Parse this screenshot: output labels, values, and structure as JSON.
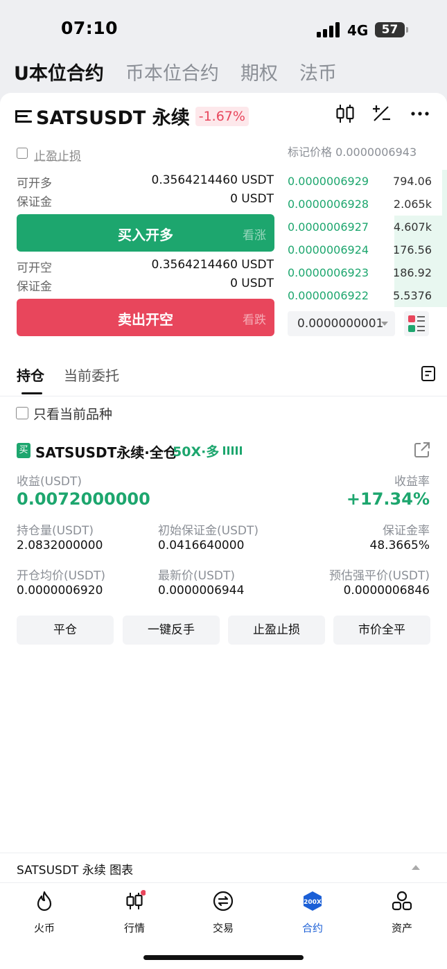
{
  "status": {
    "time": "07:10",
    "network": "4G",
    "battery": "57"
  },
  "top_tabs": [
    "U本位合约",
    "币本位合约",
    "期权",
    "法币"
  ],
  "header": {
    "pair": "SATSUSDT 永续",
    "change": "-1.67%"
  },
  "trade": {
    "tp_sl_label": "止盈止损",
    "long_avail_label": "可开多",
    "long_avail_value": "0.3564214460 USDT",
    "long_margin_label": "保证金",
    "long_margin_value": "0 USDT",
    "buy_button": "买入开多",
    "buy_hint": "看涨",
    "short_avail_label": "可开空",
    "short_avail_value": "0.3564214460 USDT",
    "short_margin_label": "保证金",
    "short_margin_value": "0 USDT",
    "sell_button": "卖出开空",
    "sell_hint": "看跌"
  },
  "orderbook": {
    "mark_price": "标记价格 0.0000006943",
    "rows": [
      {
        "price": "0.0000006929",
        "qty": "794.06",
        "depth": 0.03
      },
      {
        "price": "0.0000006928",
        "qty": "2.065k",
        "depth": 0.03
      },
      {
        "price": "0.0000006927",
        "qty": "4.607k",
        "depth": 0.33
      },
      {
        "price": "0.0000006924",
        "qty": "176.56",
        "depth": 0.33
      },
      {
        "price": "0.0000006923",
        "qty": "186.92",
        "depth": 0.33
      },
      {
        "price": "0.0000006922",
        "qty": "5.5376",
        "depth": 0.33
      }
    ],
    "precision": "0.0000000001"
  },
  "positions": {
    "tabs": [
      "持仓",
      "当前委托"
    ],
    "only_current": "只看当前品种",
    "item": {
      "side_tag": "买",
      "name": "SATSUSDT永续·全仓",
      "leverage": "50X·多",
      "pnl_label": "收益(USDT)",
      "pnl_value": "0.0072000000",
      "roe_label": "收益率",
      "roe_value": "+17.34%",
      "size_label": "持仓量(USDT)",
      "size_value": "2.0832000000",
      "init_margin_label": "初始保证金(USDT)",
      "init_margin_value": "0.0416640000",
      "margin_ratio_label": "保证金率",
      "margin_ratio_value": "48.3665%",
      "entry_label": "开仓均价(USDT)",
      "entry_value": "0.0000006920",
      "last_label": "最新价(USDT)",
      "last_value": "0.0000006944",
      "liq_label": "预估强平价(USDT)",
      "liq_value": "0.0000006846"
    },
    "actions": [
      "平仓",
      "一键反手",
      "止盈止损",
      "市价全平"
    ]
  },
  "chart_bar": "SATSUSDT 永续 图表",
  "nav": [
    {
      "label": "火币"
    },
    {
      "label": "行情"
    },
    {
      "label": "交易"
    },
    {
      "label": "合约",
      "badge": "200X"
    },
    {
      "label": "资产"
    }
  ],
  "colors": {
    "green": "#1da66e",
    "red": "#e8465c",
    "blue": "#1b5fd6"
  }
}
